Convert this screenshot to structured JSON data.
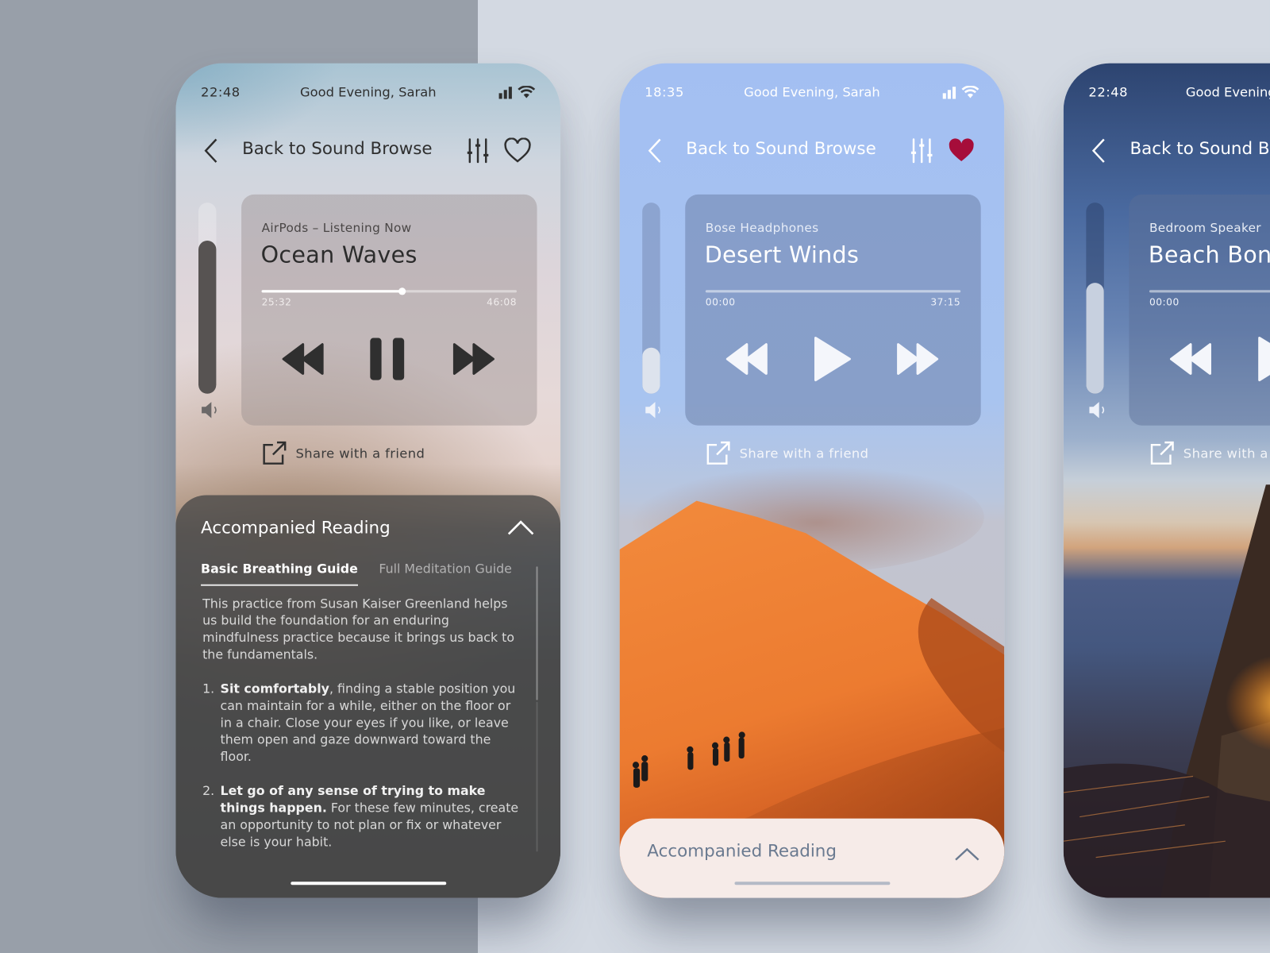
{
  "screens": [
    {
      "status": {
        "time": "22:48",
        "greeting": "Good Evening, Sarah"
      },
      "nav": {
        "back_label": "Back to Sound Browse",
        "favorited": false
      },
      "player": {
        "device": "AirPods – Listening Now",
        "track": "Ocean Waves",
        "elapsed": "25:32",
        "duration": "46:08",
        "progress_fraction": 0.55,
        "state": "playing",
        "volume_fraction": 0.8
      },
      "share_label": "Share with a friend",
      "reading": {
        "title": "Accompanied Reading",
        "expanded": true,
        "tabs": [
          {
            "label": "Basic Breathing Guide",
            "active": true
          },
          {
            "label": "Full Meditation Guide",
            "active": false
          }
        ],
        "intro": "This practice from Susan Kaiser Greenland helps us build the foundation for an enduring mindfulness practice because it brings us back to the fundamentals.",
        "steps": [
          {
            "num": "1.",
            "bold": "Sit comfortably",
            "text": ", finding a stable position you can maintain for a while, either on the floor or in a chair. Close your eyes if you like, or leave them open and gaze downward toward the floor."
          },
          {
            "num": "2.",
            "bold": "Let go of any sense of trying to make things happen.",
            "text": " For these few minutes, create an opportunity to not plan or fix or whatever else is your habit."
          }
        ]
      }
    },
    {
      "status": {
        "time": "18:35",
        "greeting": "Good Evening, Sarah"
      },
      "nav": {
        "back_label": "Back to Sound Browse",
        "favorited": true
      },
      "player": {
        "device": "Bose Headphones",
        "track": "Desert Winds",
        "elapsed": "00:00",
        "duration": "37:15",
        "progress_fraction": 0.0,
        "state": "paused",
        "volume_fraction": 0.24
      },
      "share_label": "Share with a friend",
      "reading": {
        "title": "Accompanied Reading",
        "expanded": false
      }
    },
    {
      "status": {
        "time": "22:48",
        "greeting": "Good Evening, Sarah"
      },
      "nav": {
        "back_label": "Back to Sound Browse"
      },
      "player": {
        "device": "Bedroom Speaker",
        "track": "Beach Bonfire",
        "elapsed": "00:00",
        "state": "paused",
        "volume_fraction": 0.58
      },
      "share_label": "Share with a friend"
    }
  ],
  "colors": {
    "heart_active": "#a60d3a",
    "background_left": "#989fa9",
    "background_right": "#d3d9e2",
    "reading_panel_dark": "#484848",
    "reading_panel_light": "#f6ebe8"
  }
}
